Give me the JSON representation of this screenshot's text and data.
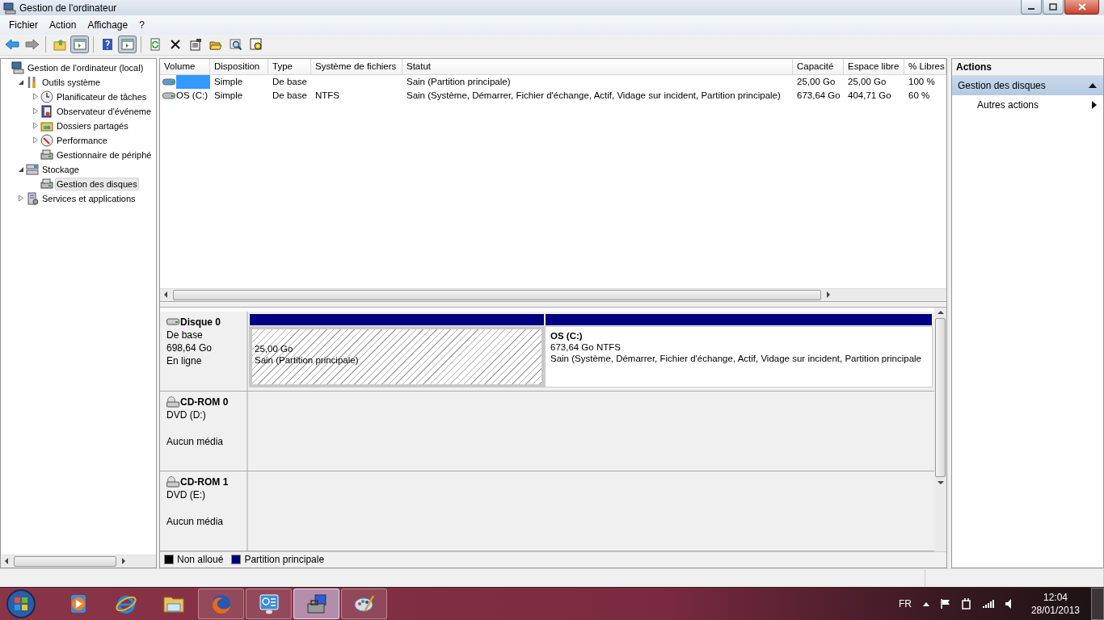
{
  "window": {
    "title": "Gestion de l'ordinateur"
  },
  "menu": [
    "Fichier",
    "Action",
    "Affichage",
    "?"
  ],
  "toolbar": [
    [
      {
        "kind": "back",
        "pressed": false
      },
      {
        "kind": "forward",
        "pressed": false
      }
    ],
    [
      {
        "kind": "up",
        "pressed": false
      },
      {
        "kind": "pane",
        "pressed": true
      }
    ],
    [
      {
        "kind": "help",
        "pressed": false
      },
      {
        "kind": "pane",
        "pressed": true
      }
    ],
    [
      {
        "kind": "refresh",
        "pressed": false
      },
      {
        "kind": "delete",
        "pressed": false
      },
      {
        "kind": "properties",
        "pressed": false
      },
      {
        "kind": "open",
        "pressed": false
      },
      {
        "kind": "find",
        "pressed": false
      },
      {
        "kind": "gear",
        "pressed": false
      }
    ]
  ],
  "tree": [
    {
      "label": "Gestion de l'ordinateur (local)",
      "kind": "computer",
      "selected": false,
      "children": [
        {
          "label": "Outils système",
          "kind": "tools",
          "expanded": true,
          "selected": false,
          "children": [
            {
              "label": "Planificateur de tâches",
              "kind": "clock",
              "expanded": false,
              "selected": false
            },
            {
              "label": "Observateur d'événeme",
              "kind": "log",
              "expanded": false,
              "selected": false
            },
            {
              "label": "Dossiers partagés",
              "kind": "share",
              "expanded": false,
              "selected": false
            },
            {
              "label": "Performance",
              "kind": "perf",
              "expanded": false,
              "selected": false
            },
            {
              "label": "Gestionnaire de périphé",
              "kind": "device",
              "selected": false
            }
          ]
        },
        {
          "label": "Stockage",
          "kind": "storage",
          "expanded": true,
          "selected": false,
          "children": [
            {
              "label": "Gestion des disques",
              "kind": "disk",
              "selected": true
            }
          ]
        },
        {
          "label": "Services et applications",
          "kind": "services",
          "expanded": false,
          "selected": false
        }
      ]
    }
  ],
  "volumes": {
    "columns": [
      "Volume",
      "Disposition",
      "Type",
      "Système de fichiers",
      "Statut",
      "Capacité",
      "Espace libre",
      "% Libres"
    ],
    "rows": [
      {
        "selected": true,
        "layout": "Simple",
        "type": "De base",
        "status": "Sain (Partition principale)",
        "capacity": "25,00 Go",
        "free": "25,00 Go",
        "pct_free": "100 %"
      },
      {
        "selected": false,
        "volume": "OS (C:)",
        "layout": "Simple",
        "type": "De base",
        "fs": "NTFS",
        "status": "Sain (Système, Démarrer, Fichier d'échange, Actif, Vidage sur incident, Partition principale)",
        "capacity": "673,64 Go",
        "free": "404,71 Go",
        "pct_free": "60 %"
      }
    ]
  },
  "disks": [
    {
      "kind": "disk",
      "name": "Disque 0",
      "lines": [
        "De base",
        "698,64 Go",
        "En ligne"
      ],
      "partitions": [
        {
          "selected": true,
          "size": "25,00 Go",
          "status": "Sain (Partition principale)"
        },
        {
          "selected": false,
          "label": "OS  (C:)",
          "size": "673,64 Go NTFS",
          "status": "Sain (Système, Démarrer, Fichier d'échange, Actif, Vidage sur incident, Partition principale"
        }
      ]
    },
    {
      "kind": "cdrom",
      "name": "CD-ROM 0",
      "drive": "DVD (D:)",
      "media": "Aucun média"
    },
    {
      "kind": "cdrom",
      "name": "CD-ROM 1",
      "drive": "DVD (E:)",
      "media": "Aucun média"
    }
  ],
  "legend": [
    {
      "label": "Non alloué",
      "color": "#000000"
    },
    {
      "label": "Partition principale",
      "color": "#000080"
    }
  ],
  "actions": {
    "title": "Actions",
    "sections": [
      {
        "label": "Gestion des disques",
        "expanded": true,
        "items": [
          "Autres actions"
        ]
      }
    ]
  },
  "taskbar": {
    "apps": [
      {
        "kind": "player",
        "running": false,
        "active": false
      },
      {
        "kind": "globe",
        "running": false,
        "active": false
      },
      {
        "kind": "folder",
        "running": false,
        "active": false
      },
      {
        "kind": "fox",
        "running": true,
        "active": false
      },
      {
        "kind": "panel",
        "running": true,
        "active": false
      },
      {
        "kind": "toolbox",
        "running": true,
        "active": true
      },
      {
        "kind": "palette",
        "running": true,
        "active": false
      }
    ],
    "tray": {
      "language": "FR",
      "time": "12:04",
      "date": "28/01/2013"
    }
  }
}
